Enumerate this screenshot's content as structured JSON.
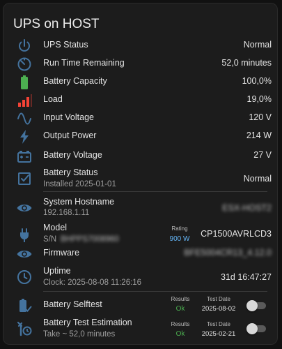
{
  "card": {
    "title": "UPS on HOST"
  },
  "rows": {
    "ups_status": {
      "label": "UPS Status",
      "value": "Normal",
      "icon": "power-icon"
    },
    "runtime": {
      "label": "Run Time Remaining",
      "value": "52,0 minutes",
      "icon": "timer-icon"
    },
    "capacity": {
      "label": "Battery Capacity",
      "value": "100,0%",
      "icon": "battery-full-icon"
    },
    "load": {
      "label": "Load",
      "value": "19,0%",
      "icon": "signal-bars-icon"
    },
    "input_voltage": {
      "label": "Input Voltage",
      "value": "120 V",
      "icon": "sine-wave-icon"
    },
    "output_power": {
      "label": "Output Power",
      "value": "214 W",
      "icon": "lightning-bolt-icon"
    },
    "battery_voltage": {
      "label": "Battery Voltage",
      "value": "27 V",
      "icon": "car-battery-icon"
    },
    "battery_status": {
      "label": "Battery Status",
      "sub": "Installed 2025-01-01",
      "value": "Normal",
      "icon": "checkbox-icon"
    },
    "hostname": {
      "label": "System Hostname",
      "sub": "192.168.1.11",
      "value": "ESX-HOST2",
      "icon": "eye-icon"
    },
    "model": {
      "label": "Model",
      "sub_prefix": "S/N",
      "sub_value": "BHPPS7008960",
      "rating_label": "Rating",
      "rating_value": "900 W",
      "value": "CP1500AVRLCD3",
      "icon": "power-plug-icon"
    },
    "firmware": {
      "label": "Firmware",
      "value": "BFE5004CR13_4.12.0",
      "icon": "eye-icon"
    },
    "uptime": {
      "label": "Uptime",
      "sub": "Clock: 2025-08-08 11:26:16",
      "value": "31d 16:47:27",
      "icon": "clock-icon"
    },
    "selftest": {
      "label": "Battery Selftest",
      "results_label": "Results",
      "results_value": "Ok",
      "date_label": "Test Date",
      "date_value": "2025-08-02",
      "toggle_on": false,
      "icon": "battery-check-icon"
    },
    "estimation": {
      "label": "Battery Test Estimation",
      "sub": "Take ~ 52,0 minutes",
      "results_label": "Results",
      "results_value": "Ok",
      "date_label": "Test Date",
      "date_value": "2025-02-21",
      "toggle_on": false,
      "icon": "wrench-clock-icon"
    }
  },
  "colors": {
    "icon_blue": "#44739e",
    "green": "#4caf50",
    "red": "#f44336",
    "rating_blue": "#64b5f6"
  }
}
